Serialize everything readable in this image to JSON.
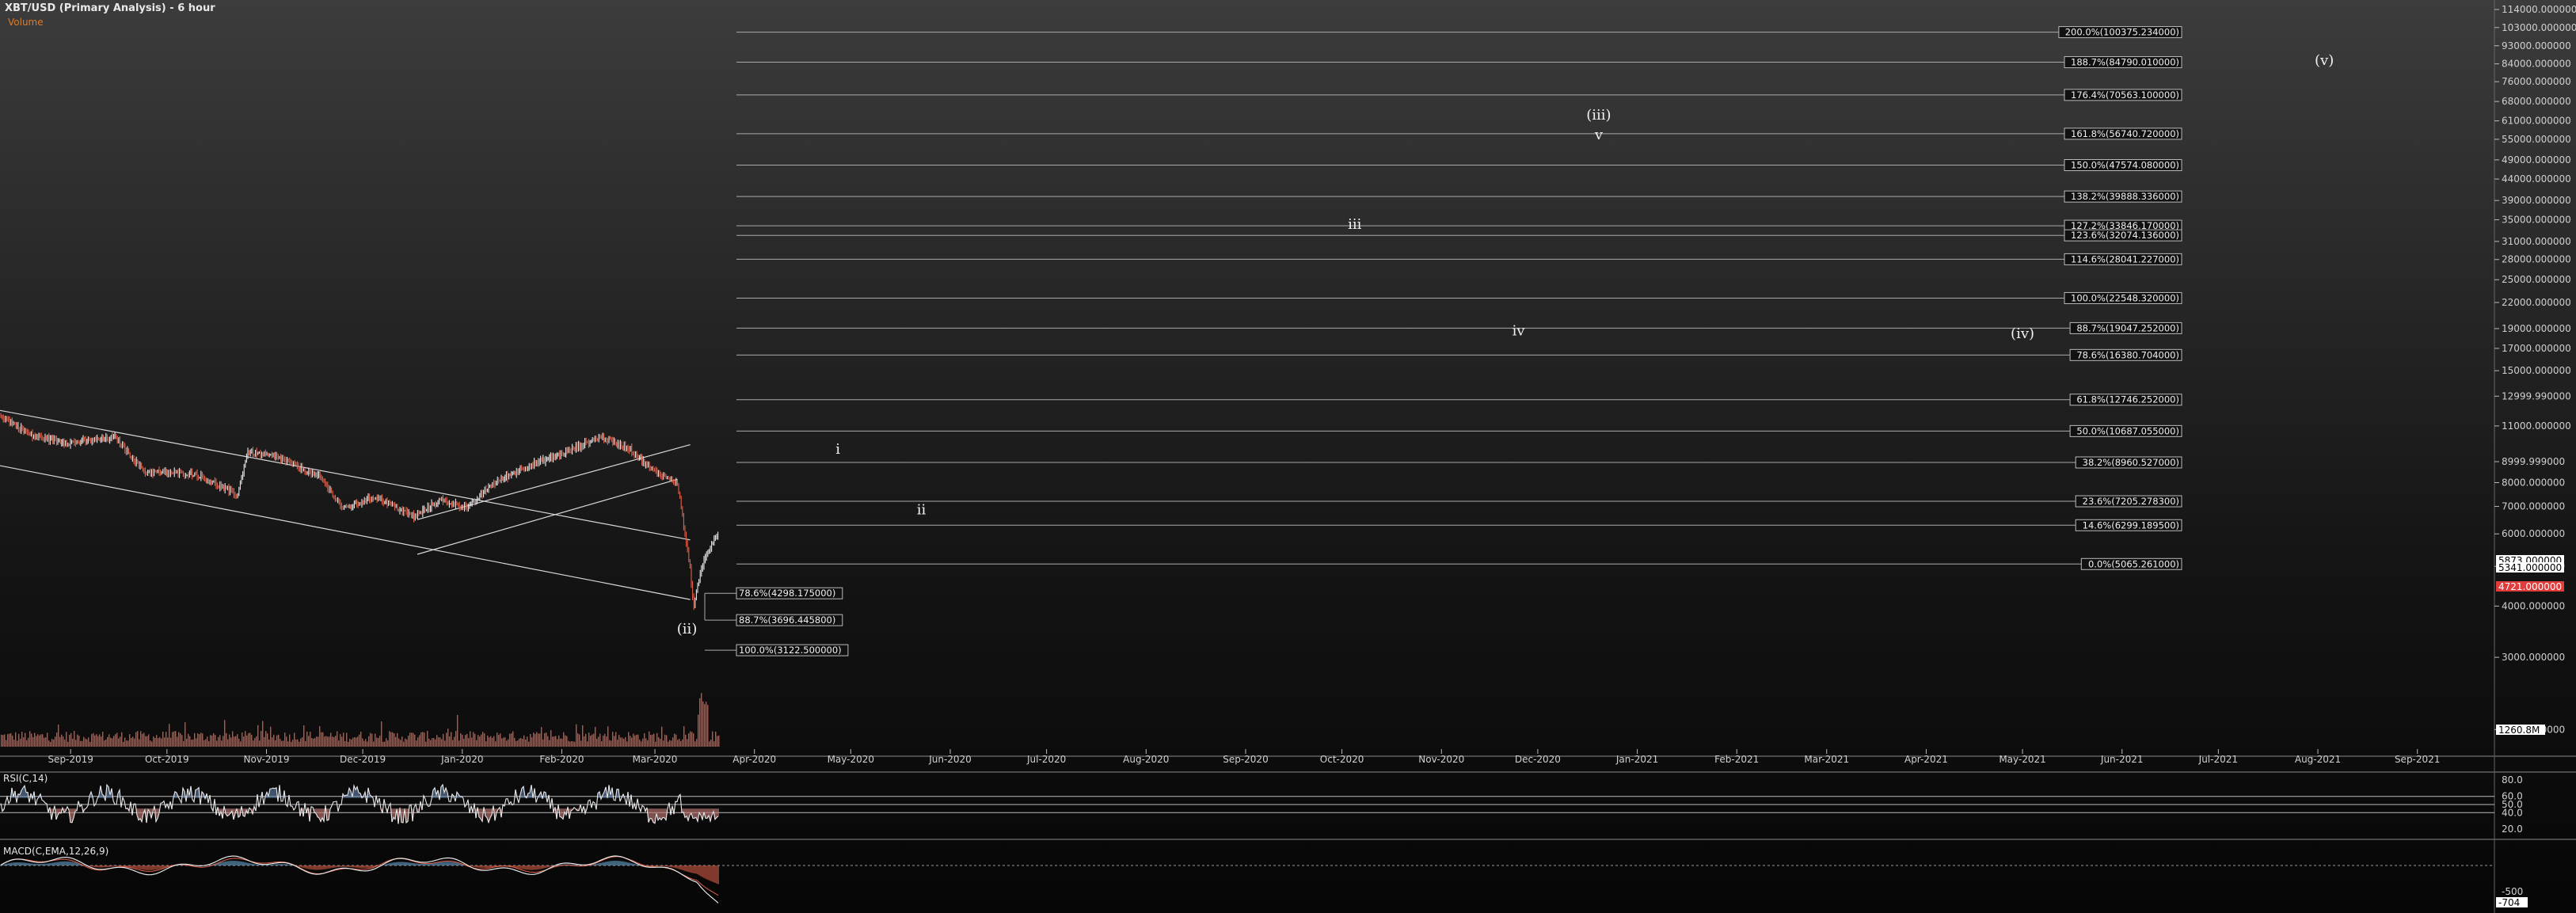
{
  "header": {
    "title": "XBT/USD (Primary Analysis) - 6 hour",
    "volume_label": "Volume"
  },
  "colors": {
    "up": "#6fa8d6",
    "down": "#e0614a",
    "volume": "#e0614a",
    "line": "#d8d8d8",
    "fib_line": "#aaaaaa",
    "last_price_bg": "#ffffff",
    "low_price_bg": "#e03c3c",
    "grid_text": "#d0d0d0"
  },
  "chart_data": [
    {
      "type": "line",
      "name": "price",
      "scale": "log",
      "ylim": [
        1800,
        115000
      ],
      "y_ticks": [
        "114000.000000",
        "103000.000000",
        "93000.000000",
        "84000.000000",
        "76000.000000",
        "68000.000000",
        "61000.000000",
        "55000.000000",
        "49000.000000",
        "44000.000000",
        "39000.000000",
        "35000.000000",
        "31000.000000",
        "28000.000000",
        "25000.000000",
        "22000.000000",
        "19000.000000",
        "17000.000000",
        "15000.000000",
        "12999.990000",
        "11000.000000",
        "8999.999000",
        "8000.000000",
        "7000.000000",
        "6000.000000",
        "5000.000000",
        "4000.000000",
        "3000.000000",
        "2000.000000"
      ],
      "x_ticks": [
        "Sep-2019",
        "Oct-2019",
        "Nov-2019",
        "Dec-2019",
        "Jan-2020",
        "Feb-2020",
        "Mar-2020",
        "Apr-2020",
        "May-2020",
        "Jun-2020",
        "Jul-2020",
        "Aug-2020",
        "Sep-2020",
        "Oct-2020",
        "Nov-2020",
        "Dec-2020",
        "Jan-2021",
        "Feb-2021",
        "Mar-2021",
        "Apr-2021",
        "May-2021",
        "Jun-2021",
        "Jul-2021",
        "Aug-2021",
        "Sep-2021"
      ],
      "x_start": "2019-08-10",
      "x_end": "2021-09-25",
      "price_points": [
        [
          "2019-08-10",
          11700
        ],
        [
          "2019-08-20",
          10400
        ],
        [
          "2019-09-01",
          10000
        ],
        [
          "2019-09-15",
          10300
        ],
        [
          "2019-09-24",
          8500
        ],
        [
          "2019-10-10",
          8400
        ],
        [
          "2019-10-23",
          7450
        ],
        [
          "2019-10-26",
          9500
        ],
        [
          "2019-11-05",
          9200
        ],
        [
          "2019-11-18",
          8200
        ],
        [
          "2019-11-25",
          6900
        ],
        [
          "2019-12-05",
          7400
        ],
        [
          "2019-12-17",
          6600
        ],
        [
          "2019-12-25",
          7250
        ],
        [
          "2020-01-03",
          6950
        ],
        [
          "2020-01-10",
          7900
        ],
        [
          "2020-01-20",
          8700
        ],
        [
          "2020-02-01",
          9400
        ],
        [
          "2020-02-13",
          10350
        ],
        [
          "2020-02-22",
          9700
        ],
        [
          "2020-02-29",
          8600
        ],
        [
          "2020-03-08",
          8000
        ],
        [
          "2020-03-12",
          4900
        ],
        [
          "2020-03-13",
          4000
        ],
        [
          "2020-03-16",
          5100
        ],
        [
          "2020-03-20",
          6000
        ],
        [
          "2020-03-21",
          5900
        ]
      ],
      "last_price_labels": [
        {
          "text": "5873.000000",
          "value": 5873,
          "style": "white"
        },
        {
          "text": "5341.000000",
          "value": 5341,
          "style": "white"
        },
        {
          "text": "4721.000000",
          "value": 4721,
          "style": "red"
        }
      ],
      "volume_label": "1260.8M",
      "trend_channels": [
        {
          "from": [
            "2019-08-10",
            12000
          ],
          "to": [
            "2020-03-12",
            5800
          ]
        },
        {
          "from": [
            "2019-08-10",
            8800
          ],
          "to": [
            "2020-03-12",
            4150
          ]
        },
        {
          "from": [
            "2019-12-18",
            6500
          ],
          "to": [
            "2020-03-12",
            9900
          ]
        },
        {
          "from": [
            "2019-12-18",
            5350
          ],
          "to": [
            "2020-03-08",
            8150
          ]
        }
      ],
      "fib_levels_up": [
        {
          "label": "200.0%(100375.234000)",
          "value": 100375.234
        },
        {
          "label": "188.7%(84790.010000)",
          "value": 84790.01
        },
        {
          "label": "176.4%(70563.100000)",
          "value": 70563.1
        },
        {
          "label": "161.8%(56740.720000)",
          "value": 56740.72
        },
        {
          "label": "150.0%(47574.080000)",
          "value": 47574.08
        },
        {
          "label": "138.2%(39888.336000)",
          "value": 39888.336
        },
        {
          "label": "127.2%(33846.170000)",
          "value": 33846.17
        },
        {
          "label": "123.6%(32074.136000)",
          "value": 32074.136
        },
        {
          "label": "114.6%(28041.227000)",
          "value": 28041.227
        },
        {
          "label": "100.0%(22548.320000)",
          "value": 22548.32
        },
        {
          "label": "88.7%(19047.252000)",
          "value": 19047.252
        },
        {
          "label": "78.6%(16380.704000)",
          "value": 16380.704
        },
        {
          "label": "61.8%(12746.252000)",
          "value": 12746.252
        },
        {
          "label": "50.0%(10687.055000)",
          "value": 10687.055
        },
        {
          "label": "38.2%(8960.527000)",
          "value": 8960.527
        },
        {
          "label": "23.6%(7205.278300)",
          "value": 7205.2783
        },
        {
          "label": "14.6%(6299.189500)",
          "value": 6299.1895
        },
        {
          "label": "0.0%(5065.261000)",
          "value": 5065.261
        }
      ],
      "fib_levels_down": [
        {
          "label": "78.6%(4298.175000)",
          "value": 4298.175
        },
        {
          "label": "88.7%(3696.445800)",
          "value": 3696.4458
        },
        {
          "label": "100.0%(3122.500000)",
          "value": 3122.5
        }
      ],
      "wave_labels": [
        {
          "text": "i",
          "date": "2020-04-27",
          "value": 9400
        },
        {
          "text": "ii",
          "date": "2020-05-23",
          "value": 6700
        },
        {
          "text": "iii",
          "date": "2020-10-05",
          "value": 33300
        },
        {
          "text": "(iii)",
          "date": "2020-12-20",
          "value": 61500
        },
        {
          "text": "v",
          "date": "2020-12-20",
          "value": 55000
        },
        {
          "text": "iv",
          "date": "2020-11-25",
          "value": 18300
        },
        {
          "text": "(iv)",
          "date": "2021-05-01",
          "value": 18000
        },
        {
          "text": "(v)",
          "date": "2021-08-03",
          "value": 83500
        },
        {
          "text": "(ii)",
          "date": "2020-03-11",
          "value": 3430
        }
      ]
    },
    {
      "type": "line",
      "name": "RSI(C,14)",
      "ylim": [
        15,
        85
      ],
      "y_ticks": [
        "80.0",
        "60.0",
        "50.0",
        "40.0",
        "20.0"
      ]
    },
    {
      "type": "line",
      "name": "MACD(C,EMA,12,26,9)",
      "y_ticks": [
        "-500",
        "-704"
      ]
    }
  ]
}
